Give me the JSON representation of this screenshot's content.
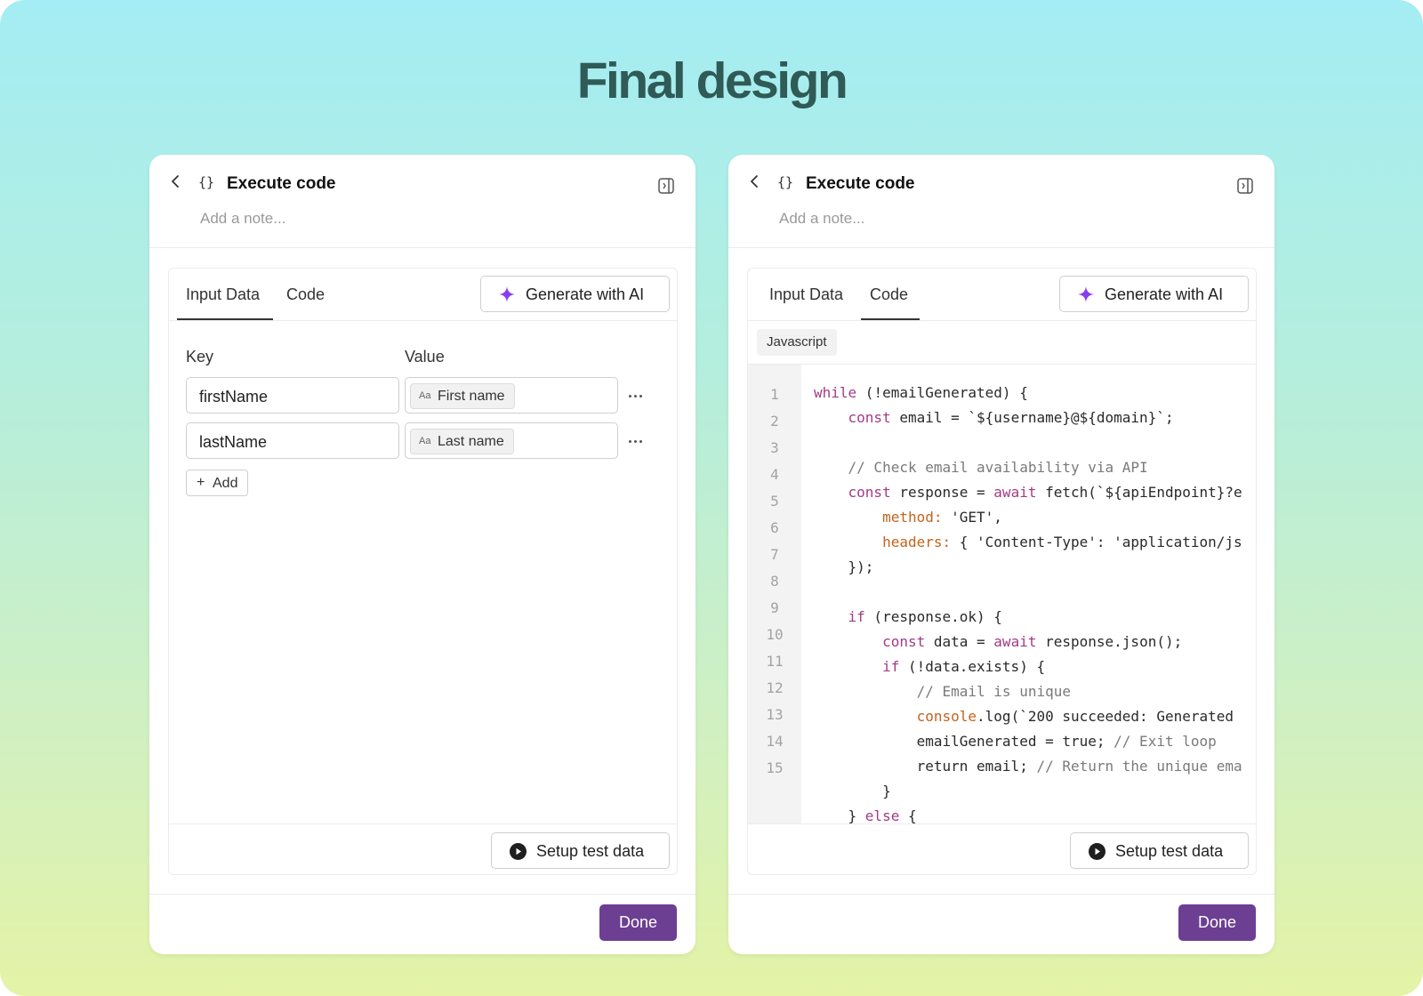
{
  "page": {
    "title": "Final design"
  },
  "panels": [
    {
      "title": "Execute code",
      "note_placeholder": "Add a note...",
      "tabs": [
        "Input Data",
        "Code"
      ],
      "active_tab": "Input Data",
      "generate_label": "Generate with AI",
      "columns": {
        "key": "Key",
        "value": "Value"
      },
      "rows": [
        {
          "key": "firstName",
          "value_chip": "First name",
          "chip_icon": "Aa"
        },
        {
          "key": "lastName",
          "value_chip": "Last name",
          "chip_icon": "Aa"
        }
      ],
      "add_label": "Add",
      "setup_label": "Setup test data",
      "done_label": "Done"
    },
    {
      "title": "Execute code",
      "note_placeholder": "Add a note...",
      "tabs": [
        "Input Data",
        "Code"
      ],
      "active_tab": "Code",
      "generate_label": "Generate with AI",
      "language": "Javascript",
      "line_numbers": [
        "1",
        "2",
        "3",
        "4",
        "5",
        "6",
        "7",
        "8",
        "9",
        "10",
        "11",
        "12",
        "13",
        "14",
        "15"
      ],
      "code_lines": [
        "while (!emailGenerated) {",
        "    const email = `${username}@${domain}`;",
        "",
        "    // Check email availability via API",
        "    const response = await fetch(`${apiEndpoint}?e",
        "        method: 'GET',",
        "        headers: { 'Content-Type': 'application/js",
        "    });",
        "",
        "    if (response.ok) {",
        "        const data = await response.json();",
        "        if (!data.exists) {",
        "            // Email is unique",
        "            console.log(`200 succeeded: Generated",
        "            emailGenerated = true; // Exit loop",
        "            return email; // Return the unique ema",
        "        }",
        "    } else {"
      ],
      "setup_label": "Setup test data",
      "done_label": "Done"
    }
  ],
  "colors": {
    "accent": "#6c3f93",
    "ai_star": "#8b3cf0",
    "keyword": "#a23b86",
    "property": "#c4621c",
    "comment": "#7a7a7a"
  },
  "icons": {
    "back": "chevron-left-icon",
    "braces": "code-braces-icon",
    "toggle": "panel-toggle-icon",
    "star": "sparkle-icon",
    "play": "play-circle-icon",
    "more": "more-dots-icon",
    "plus": "plus-icon"
  }
}
